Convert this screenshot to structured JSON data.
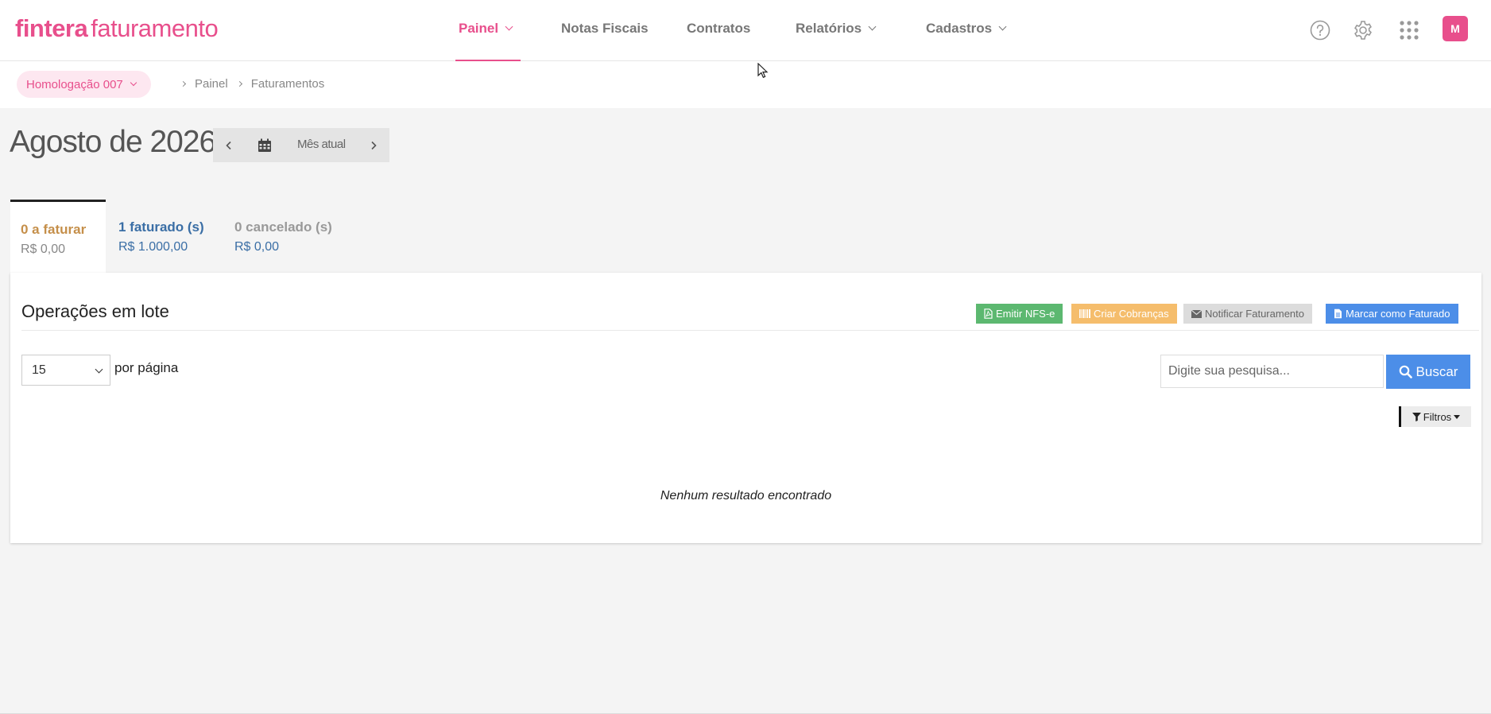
{
  "brand": {
    "name_bold": "fintera",
    "name_light": "faturamento",
    "color": "#e84f8c"
  },
  "nav": {
    "items": [
      {
        "label": "Painel",
        "active": true,
        "has_dropdown": true
      },
      {
        "label": "Notas Fiscais",
        "active": false,
        "has_dropdown": false
      },
      {
        "label": "Contratos",
        "active": false,
        "has_dropdown": false
      },
      {
        "label": "Relatórios",
        "active": false,
        "has_dropdown": true
      },
      {
        "label": "Cadastros",
        "active": false,
        "has_dropdown": true
      }
    ],
    "icons": [
      "help-icon",
      "gear-icon",
      "apps-grid-icon"
    ],
    "avatar_initial": "M"
  },
  "breadcrumb": {
    "environment": "Homologação 007",
    "items": [
      "Painel",
      "Faturamentos"
    ]
  },
  "month": {
    "title": "Agosto de 2026",
    "current_label": "Mês atual"
  },
  "status_tabs": [
    {
      "title": "0 a faturar",
      "value": "R$ 0,00",
      "active": true,
      "title_color": "#c58f4a",
      "value_color": "#888888"
    },
    {
      "title": "1 faturado (s)",
      "value": "R$ 1.000,00",
      "active": false,
      "title_color": "#3a6ea5",
      "value_color": "#3a6ea5"
    },
    {
      "title": "0 cancelado (s)",
      "value": "R$ 0,00",
      "active": false,
      "title_color": "#999999",
      "value_color": "#3a6ea5"
    }
  ],
  "panel": {
    "title": "Operações em lote",
    "bulk_actions": [
      {
        "label": "Emitir NFS-e",
        "color": "#5cb870",
        "icon": "file-pdf-icon"
      },
      {
        "label": "Criar Cobranças",
        "color": "#f5bd6c",
        "icon": "barcode-icon"
      },
      {
        "label": "Notificar Faturamento",
        "color": "#dcdcdc",
        "icon": "envelope-icon"
      },
      {
        "label": "Marcar como Faturado",
        "color": "#4c8ee8",
        "icon": "file-text-icon"
      }
    ],
    "per_page": {
      "value": "15",
      "label": "por página"
    },
    "search": {
      "placeholder": "Digite sua pesquisa...",
      "button_label": "Buscar"
    },
    "filters_label": "Filtros",
    "empty_message": "Nenhum resultado encontrado"
  }
}
